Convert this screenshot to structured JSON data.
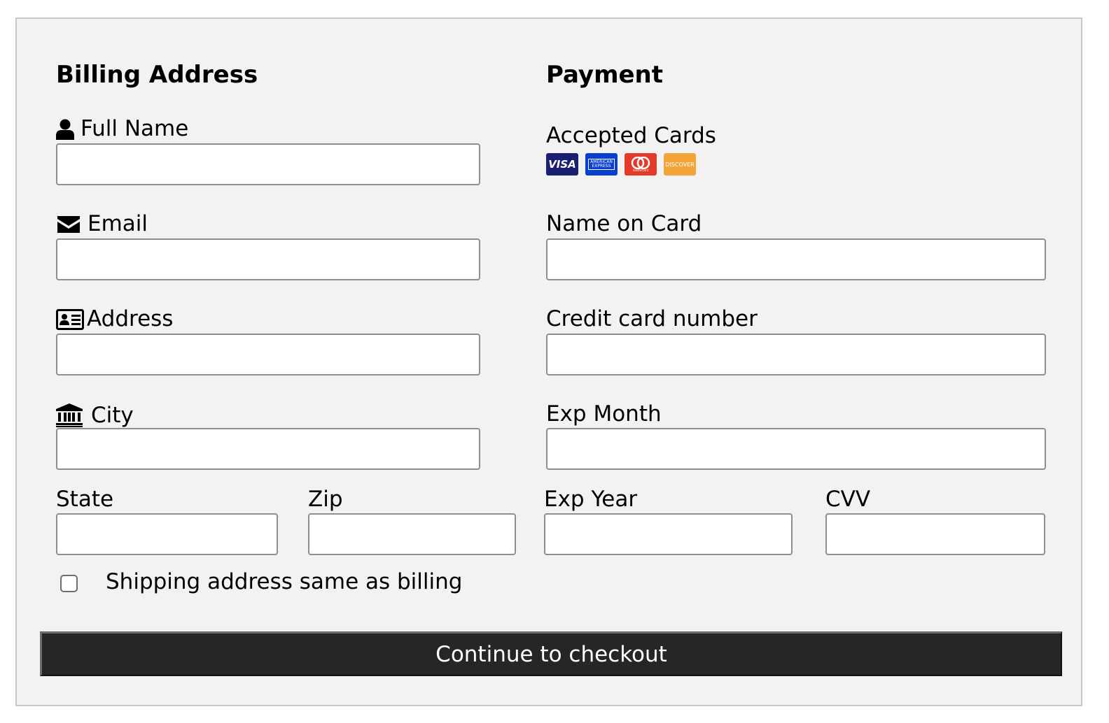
{
  "billing": {
    "heading": "Billing Address",
    "full_name": {
      "label": "Full Name",
      "icon": "user-icon",
      "value": "",
      "placeholder": ""
    },
    "email": {
      "label": "Email",
      "icon": "envelope-icon",
      "value": "",
      "placeholder": ""
    },
    "address": {
      "label": "Address",
      "icon": "address-card-icon",
      "value": "",
      "placeholder": ""
    },
    "city": {
      "label": "City",
      "icon": "institution-icon",
      "value": "",
      "placeholder": ""
    },
    "state": {
      "label": "State",
      "value": "",
      "placeholder": ""
    },
    "zip": {
      "label": "Zip",
      "value": "",
      "placeholder": ""
    }
  },
  "payment": {
    "heading": "Payment",
    "accepted_cards_label": "Accepted Cards",
    "cards": [
      {
        "icon": "visa-card-icon",
        "text": "VISA",
        "color": "#1a1f71"
      },
      {
        "icon": "amex-card-icon",
        "text": "AMERICAN EXPRESS",
        "color": "#0a3fd0"
      },
      {
        "icon": "mastercard-card-icon",
        "text": "mastercard",
        "color": "#e23b2a"
      },
      {
        "icon": "discover-card-icon",
        "text": "DISCOVER",
        "color": "#f3a53a"
      }
    ],
    "name_on_card": {
      "label": "Name on Card",
      "value": "",
      "placeholder": ""
    },
    "card_number": {
      "label": "Credit card number",
      "value": "",
      "placeholder": ""
    },
    "exp_month": {
      "label": "Exp Month",
      "value": "",
      "placeholder": ""
    },
    "exp_year": {
      "label": "Exp Year",
      "value": "",
      "placeholder": ""
    },
    "cvv": {
      "label": "CVV",
      "value": "",
      "placeholder": ""
    }
  },
  "shipping_same": {
    "label": "Shipping address same as billing",
    "checked": false
  },
  "submit": {
    "label": "Continue to checkout",
    "color": "#262626"
  }
}
